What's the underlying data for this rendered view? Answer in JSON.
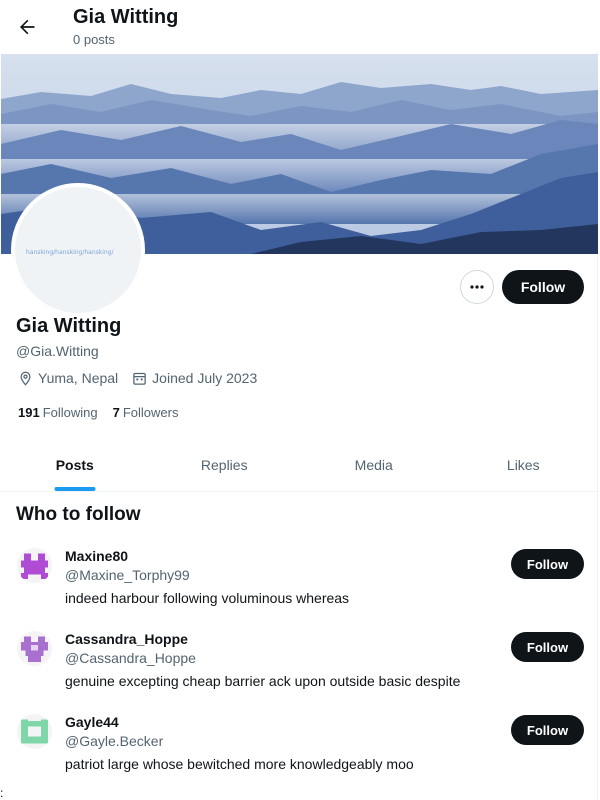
{
  "header": {
    "name": "Gia Witting",
    "posts": "0 posts"
  },
  "profile": {
    "avatar_alt": "hansking/hansking/hansking/",
    "name": "Gia Witting",
    "handle": "@Gia.Witting",
    "location": "Yuma, Nepal",
    "joined": "Joined July 2023",
    "following_count": "191",
    "following_label": "Following",
    "followers_count": "7",
    "followers_label": "Followers",
    "follow_label": "Follow"
  },
  "tabs": [
    {
      "label": "Posts",
      "active": true
    },
    {
      "label": "Replies",
      "active": false
    },
    {
      "label": "Media",
      "active": false
    },
    {
      "label": "Likes",
      "active": false
    }
  ],
  "who_to_follow": {
    "title": "Who to follow",
    "users": [
      {
        "name": "Maxine80",
        "handle": "@Maxine_Torphy99",
        "bio": "indeed harbour following voluminous whereas",
        "follow_label": "Follow",
        "avatar_color": "#b04bd6"
      },
      {
        "name": "Cassandra_Hoppe",
        "handle": "@Cassandra_Hoppe",
        "bio": "genuine excepting cheap barrier ack upon outside basic despite",
        "follow_label": "Follow",
        "avatar_color": "#a970d0"
      },
      {
        "name": "Gayle44",
        "handle": "@Gayle.Becker",
        "bio": "patriot large whose bewitched more knowledgeably moo",
        "follow_label": "Follow",
        "avatar_color": "#7fd6a8"
      }
    ]
  },
  "colors": {
    "accent": "#1d9bf0",
    "button": "#0f1419",
    "secondary_text": "#536471"
  },
  "stray_char": ":"
}
